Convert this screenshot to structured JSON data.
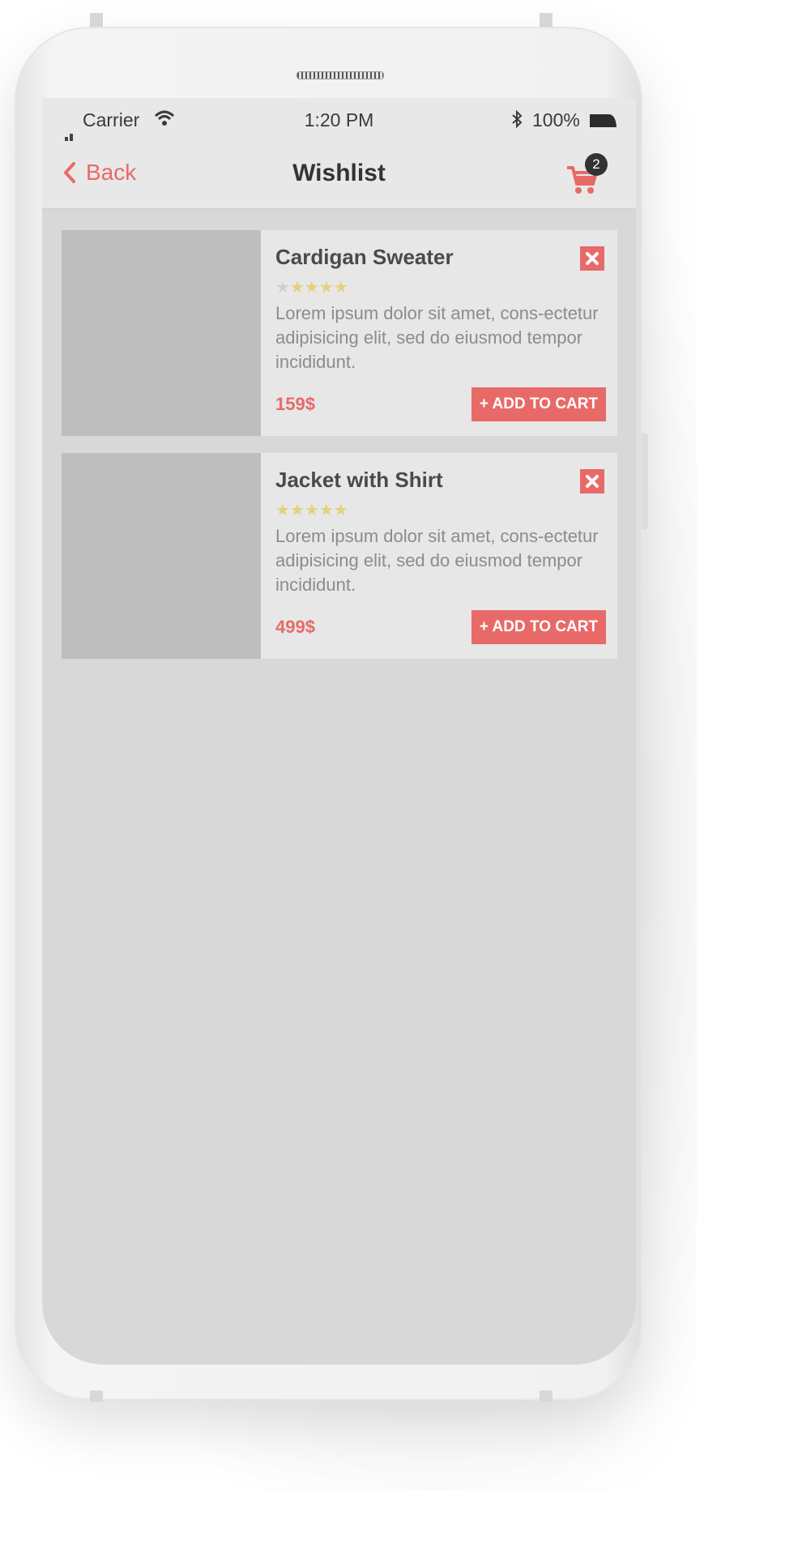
{
  "status_bar": {
    "carrier": "Carrier",
    "time": "1:20 PM",
    "battery": "100%"
  },
  "nav": {
    "back_label": "Back",
    "title": "Wishlist",
    "cart_count": "2"
  },
  "colors": {
    "accent": "#e86a68",
    "star": "#e6d07a"
  },
  "wishlist": [
    {
      "name": "Cardigan Sweater",
      "rating": 4,
      "max_rating": 5,
      "description": "Lorem ipsum dolor sit amet, cons-ectetur adipisicing elit, sed do eiusmod tempor incididunt.",
      "price": "159$",
      "add_label": "+ ADD TO CART"
    },
    {
      "name": "Jacket with Shirt",
      "rating": 5,
      "max_rating": 5,
      "description": "Lorem ipsum dolor sit amet, cons-ectetur adipisicing elit, sed do eiusmod tempor incididunt.",
      "price": "499$",
      "add_label": "+ ADD TO CART"
    }
  ]
}
